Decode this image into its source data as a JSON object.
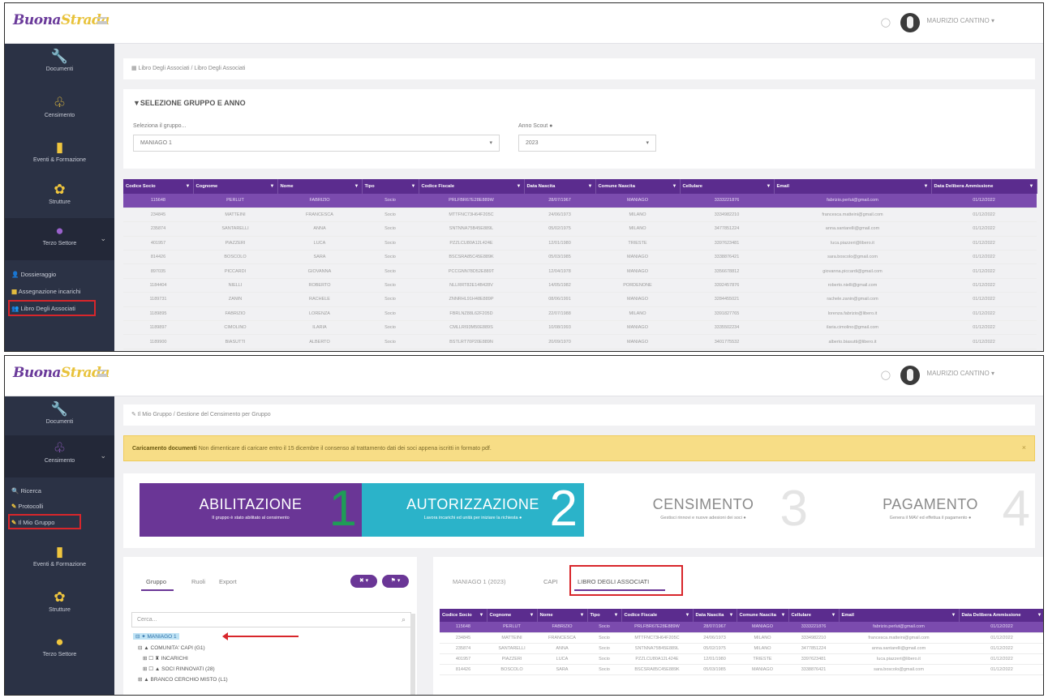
{
  "app": {
    "logo_part1": "Buona",
    "logo_part2": "Strada",
    "username": "MAURIZIO CANTINO ▾"
  },
  "screen1": {
    "sidebar": [
      {
        "icon": "wrench-icon",
        "glyph": "🔧",
        "label": "Documenti"
      },
      {
        "icon": "census-icon",
        "glyph": "♧",
        "label": "Censimento"
      },
      {
        "icon": "book-icon",
        "glyph": "▮",
        "label": "Eventi & Formazione"
      },
      {
        "icon": "structure-icon",
        "glyph": "✿",
        "label": "Strutture"
      },
      {
        "icon": "terzo-icon",
        "glyph": "●",
        "label": "Terzo Settore"
      }
    ],
    "submenu": [
      {
        "glyph": "👤",
        "label": "Dossieraggio"
      },
      {
        "glyph": "▦",
        "label": "Assegnazione incarichi"
      },
      {
        "glyph": "👥",
        "label": "Libro Degli Associati"
      }
    ],
    "breadcrumb": "▦ Libro Degli Associati / Libro Degli Associati",
    "panel_title": "▼SELEZIONE GRUPPO E ANNO",
    "group_label": "Seleziona il gruppo...",
    "group_value": "MANIAGO 1",
    "year_label": "Anno Scout ●",
    "year_value": "2023",
    "table_headers": [
      "Codice Socio",
      "Cognome",
      "Nome",
      "Tipo",
      "Codice Fiscale",
      "Data Nascita",
      "Comune Nascita",
      "Cellulare",
      "Email",
      "Data Delibera Ammissione"
    ],
    "table_rows": [
      [
        "115648",
        "PERLUT",
        "FABRIZIO",
        "Socio",
        "PRLFBR67E28E889W",
        "28/07/1967",
        "MANIAGO",
        "3333221876",
        "fabrizio.perlut@gmail.com",
        "01/12/2022"
      ],
      [
        "234845",
        "MATTEINI",
        "FRANCESCA",
        "Socio",
        "MTTFNC73H64F205C",
        "24/06/1973",
        "MILANO",
        "3334982210",
        "francesca.matteini@gmail.com",
        "01/12/2022"
      ],
      [
        "235874",
        "SANTARELLI",
        "ANNA",
        "Socio",
        "SNTNNA75B45E889L",
        "05/02/1975",
        "MILANO",
        "3477851224",
        "anna.santarelli@gmail.com",
        "01/12/2022"
      ],
      [
        "401957",
        "PIAZZERI",
        "LUCA",
        "Socio",
        "PZZLCU80A12L424E",
        "12/01/1980",
        "TRIESTE",
        "3397623481",
        "luca.piazzeri@libero.it",
        "01/12/2022"
      ],
      [
        "814426",
        "BOSCOLO",
        "SARA",
        "Socio",
        "BSCSRA85C45E889K",
        "05/03/1985",
        "MANIAGO",
        "3338876421",
        "sara.boscolo@gmail.com",
        "01/12/2022"
      ],
      [
        "897035",
        "PICCARDI",
        "GIOVANNA",
        "Socio",
        "PCCGNN78D52E889T",
        "12/04/1978",
        "MANIAGO",
        "3356678812",
        "giovanna.piccardi@gmail.com",
        "01/12/2022"
      ],
      [
        "1184404",
        "NIELLI",
        "ROBERTO",
        "Socio",
        "NLLRRT82E14B428V",
        "14/05/1982",
        "PORDENONE",
        "3392457876",
        "roberto.nielli@gmail.com",
        "01/12/2022"
      ],
      [
        "1189731",
        "ZANIN",
        "RACHELE",
        "Socio",
        "ZNNRHL91H48E889P",
        "08/06/1991",
        "MANIAGO",
        "3284455021",
        "rachele.zanin@gmail.com",
        "01/12/2022"
      ],
      [
        "1189895",
        "FABRIZIO",
        "LORENZA",
        "Socio",
        "FBRLNZ88L62F205D",
        "22/07/1988",
        "MILANO",
        "3391827765",
        "lorenza.fabrizio@libero.it",
        "01/12/2022"
      ],
      [
        "1189897",
        "CIMOLINO",
        "ILARIA",
        "Socio",
        "CMLLRI93M50E889S",
        "10/08/1993",
        "MANIAGO",
        "3335502234",
        "ilaria.cimolino@gmail.com",
        "01/12/2022"
      ],
      [
        "1189900",
        "BIASUTTI",
        "ALBERTO",
        "Socio",
        "BSTLRT70P20E889N",
        "20/09/1970",
        "MANIAGO",
        "3401775532",
        "alberto.biasutti@libero.it",
        "01/12/2022"
      ]
    ]
  },
  "screen2": {
    "sidebar": [
      {
        "icon": "wrench-icon",
        "glyph": "🔧",
        "label": "Documenti"
      },
      {
        "icon": "census-icon",
        "glyph": "♧",
        "label": "Censimento"
      }
    ],
    "submenu": [
      {
        "glyph": "🔍",
        "label": "Ricerca"
      },
      {
        "glyph": "✎",
        "label": "Protocolli"
      },
      {
        "glyph": "✎",
        "label": "Il Mio Gruppo"
      }
    ],
    "sidebar_lower": [
      {
        "icon": "book-icon",
        "glyph": "▮",
        "label": "Eventi & Formazione"
      },
      {
        "icon": "structure-icon",
        "glyph": "✿",
        "label": "Strutture"
      },
      {
        "icon": "terzo-icon",
        "glyph": "●",
        "label": "Terzo Settore"
      }
    ],
    "breadcrumb": "✎ Il Mio Gruppo / Gestione del Censimento per Gruppo",
    "alert_strong": "Caricamento documenti",
    "alert_text": " Non dimenticare di caricare entro il 15 dicembre il consenso al trattamento dati dei soci appena iscritti in formato pdf.",
    "alert_close": "×",
    "steps": [
      {
        "title": "ABILITAZIONE",
        "desc": "Il gruppo è stato abilitato al censimento",
        "num": "1"
      },
      {
        "title": "AUTORIZZAZIONE",
        "desc": "Lavora incarichi ed unità per iniziare la richiesta ●",
        "num": "2"
      },
      {
        "title": "CENSIMENTO",
        "desc": "Gestisci rinnovi e nuove adesioni dei soci ●",
        "num": "3"
      },
      {
        "title": "PAGAMENTO",
        "desc": "Genera il MAV ed effettua il pagamento ●",
        "num": "4"
      }
    ],
    "left_tabs": [
      "Gruppo",
      "Ruoli",
      "Export"
    ],
    "pill_buttons": [
      "✖ ▾",
      "⚑ ▾"
    ],
    "search_placeholder": "Cerca...",
    "tree": [
      {
        "label": "MANIAGO 1",
        "glyph": "⊟ ✦ "
      },
      {
        "label": "COMUNITA' CAPI (G1)",
        "glyph": "⊟ ▲ "
      },
      {
        "label": "INCARICHI",
        "glyph": "⊞ ☐ ♜ "
      },
      {
        "label": "SOCI RINNOVATI (28)",
        "glyph": "⊞ ☐ ▲ "
      },
      {
        "label": "BRANCO CERCHIO MISTO (L1)",
        "glyph": "⊞ ▲ "
      }
    ],
    "right_tabs": [
      "MANIAGO 1 (2023)",
      "CAPI",
      "LIBRO DEGLI ASSOCIATI"
    ],
    "table_headers": [
      "Codice Socio",
      "Cognome",
      "Nome",
      "Tipo",
      "Codice Fiscale",
      "Data Nascita",
      "Comune Nascita",
      "Cellulare",
      "Email",
      "Data Delibera Ammissione"
    ],
    "table_rows": [
      [
        "115648",
        "PERLUT",
        "FABRIZIO",
        "Socio",
        "PRLFBR67E28E889W",
        "28/07/1967",
        "MANIAGO",
        "3333221876",
        "fabrizio.perlut@gmail.com",
        "01/12/2022"
      ],
      [
        "234845",
        "MATTEINI",
        "FRANCESCA",
        "Socio",
        "MTTFNC73H64F205C",
        "24/06/1973",
        "MILANO",
        "3334982210",
        "francesca.matteini@gmail.com",
        "01/12/2022"
      ],
      [
        "235874",
        "SANTARELLI",
        "ANNA",
        "Socio",
        "SNTNNA75B45E889L",
        "05/02/1975",
        "MILANO",
        "3477851224",
        "anna.santarelli@gmail.com",
        "01/12/2022"
      ],
      [
        "401957",
        "PIAZZERI",
        "LUCA",
        "Socio",
        "PZZLCU80A12L424E",
        "12/01/1980",
        "TRIESTE",
        "3397623481",
        "luca.piazzeri@libero.it",
        "01/12/2022"
      ],
      [
        "814426",
        "BOSCOLO",
        "SARA",
        "Socio",
        "BSCSRA85C45E889K",
        "05/03/1985",
        "MANIAGO",
        "3338876421",
        "sara.boscolo@gmail.com",
        "01/12/2022"
      ]
    ]
  }
}
